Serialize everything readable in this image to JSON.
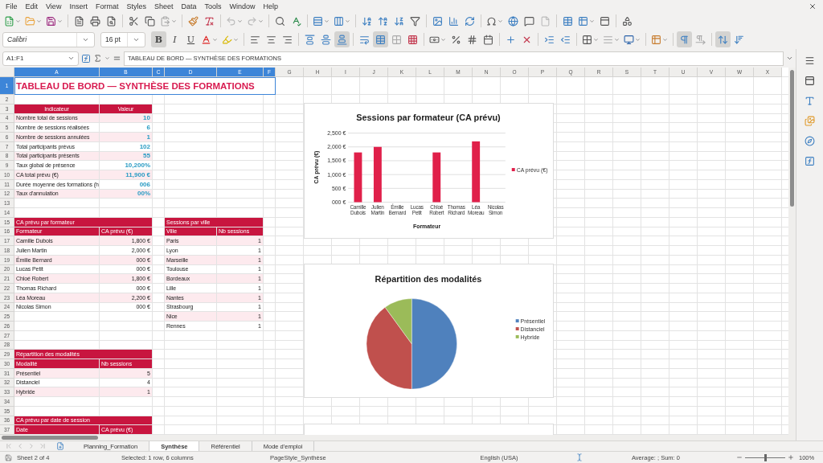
{
  "menu": [
    "File",
    "Edit",
    "View",
    "Insert",
    "Format",
    "Styles",
    "Sheet",
    "Data",
    "Tools",
    "Window",
    "Help"
  ],
  "format_toolbar": {
    "font": "Calibri",
    "size": "16 pt",
    "style_buttons": [
      {
        "label": "B",
        "pressed": true
      },
      {
        "label": "I",
        "pressed": false
      },
      {
        "label": "U",
        "pressed": false
      }
    ],
    "tools": [
      {
        "pressed": false
      },
      {
        "pressed": false
      },
      {
        "pressed": false
      },
      {
        "pressed": false
      },
      {
        "pressed": false
      },
      {
        "pressed": false
      },
      {
        "pressed": false
      },
      {
        "pressed": true
      },
      {
        "pressed": false
      },
      {
        "pressed": true
      },
      {
        "pressed": false
      },
      {
        "pressed": false
      },
      {
        "pressed": false
      },
      {
        "pressed": false
      },
      {
        "pressed": false
      },
      {
        "pressed": false
      },
      {
        "pressed": false
      },
      {
        "pressed": false
      },
      {
        "pressed": false
      },
      {
        "pressed": false
      },
      {
        "pressed": false
      },
      {
        "pressed": false
      },
      {
        "pressed": false
      },
      {
        "pressed": false
      },
      {
        "pressed": true
      },
      {
        "pressed": false
      },
      {
        "pressed": true
      },
      {
        "pressed": false
      }
    ]
  },
  "formula_bar": {
    "name_box": "A1:F1",
    "formula": "TABLEAU DE BORD — SYNTHÈSE DES FORMATIONS"
  },
  "sheet": {
    "column_headers": [
      {
        "label": "A",
        "selected": true
      },
      {
        "label": "B",
        "selected": true
      },
      {
        "label": "C",
        "selected": true
      },
      {
        "label": "D",
        "selected": true
      },
      {
        "label": "E",
        "selected": true
      },
      {
        "label": "F",
        "selected": true
      },
      {
        "label": "G",
        "selected": false
      },
      {
        "label": "H",
        "selected": false
      },
      {
        "label": "I",
        "selected": false
      },
      {
        "label": "J",
        "selected": false
      },
      {
        "label": "K",
        "selected": false
      },
      {
        "label": "L",
        "selected": false
      },
      {
        "label": "M",
        "selected": false
      },
      {
        "label": "N",
        "selected": false
      },
      {
        "label": "O",
        "selected": false
      },
      {
        "label": "P",
        "selected": false
      },
      {
        "label": "Q",
        "selected": false
      },
      {
        "label": "R",
        "selected": false
      },
      {
        "label": "S",
        "selected": false
      },
      {
        "label": "T",
        "selected": false
      },
      {
        "label": "U",
        "selected": false
      },
      {
        "label": "V",
        "selected": false
      },
      {
        "label": "W",
        "selected": false
      },
      {
        "label": "X",
        "selected": false
      }
    ],
    "row_headers": [
      {
        "label": "1",
        "selected": true
      },
      {
        "label": "2",
        "selected": false
      },
      {
        "label": "3",
        "selected": false
      },
      {
        "label": "4",
        "selected": false
      },
      {
        "label": "5",
        "selected": false
      },
      {
        "label": "6",
        "selected": false
      },
      {
        "label": "7",
        "selected": false
      },
      {
        "label": "8",
        "selected": false
      },
      {
        "label": "9",
        "selected": false
      },
      {
        "label": "10",
        "selected": false
      },
      {
        "label": "11",
        "selected": false
      },
      {
        "label": "12",
        "selected": false
      },
      {
        "label": "13",
        "selected": false
      },
      {
        "label": "14",
        "selected": false
      },
      {
        "label": "15",
        "selected": false
      },
      {
        "label": "16",
        "selected": false
      },
      {
        "label": "17",
        "selected": false
      },
      {
        "label": "18",
        "selected": false
      },
      {
        "label": "19",
        "selected": false
      },
      {
        "label": "20",
        "selected": false
      },
      {
        "label": "21",
        "selected": false
      },
      {
        "label": "22",
        "selected": false
      },
      {
        "label": "23",
        "selected": false
      },
      {
        "label": "24",
        "selected": false
      },
      {
        "label": "25",
        "selected": false
      },
      {
        "label": "26",
        "selected": false
      },
      {
        "label": "27",
        "selected": false
      },
      {
        "label": "28",
        "selected": false
      },
      {
        "label": "29",
        "selected": false
      },
      {
        "label": "30",
        "selected": false
      },
      {
        "label": "31",
        "selected": false
      },
      {
        "label": "32",
        "selected": false
      },
      {
        "label": "33",
        "selected": false
      },
      {
        "label": "34",
        "selected": false
      },
      {
        "label": "35",
        "selected": false
      },
      {
        "label": "36",
        "selected": false
      },
      {
        "label": "37",
        "selected": false
      }
    ],
    "title": "TABLEAU DE BORD — SYNTHÈSE DES FORMATIONS",
    "indicators": {
      "columns": [
        "Indicateur",
        "Valeur"
      ],
      "rows": [
        [
          "Nombre total de sessions",
          "10"
        ],
        [
          "Nombre de sessions réalisées",
          "6"
        ],
        [
          "Nombre de sessions annulées",
          "1"
        ],
        [
          "Total participants prévus",
          "102"
        ],
        [
          "Total participants présents",
          "55"
        ],
        [
          "Taux global de présence",
          "10,200%"
        ],
        [
          "CA total prévu (€)",
          "11,900 €"
        ],
        [
          "Durée moyenne des formations (h",
          "006"
        ],
        [
          "Taux d'annulation",
          "00%"
        ]
      ]
    },
    "ca_by_trainer": {
      "title": "CA prévu par formateur",
      "columns": [
        "Formateur",
        "CA prévu (€)"
      ],
      "rows": [
        [
          "Camille Dubois",
          "1,800 €"
        ],
        [
          "Julien Martin",
          "2,000 €"
        ],
        [
          "Émilie Bernard",
          "000 €"
        ],
        [
          "Lucas Petit",
          "000 €"
        ],
        [
          "Chloé Robert",
          "1,800 €"
        ],
        [
          "Thomas Richard",
          "000 €"
        ],
        [
          "Léa Moreau",
          "2,200 €"
        ],
        [
          "Nicolas Simon",
          "000 €"
        ]
      ]
    },
    "sessions_by_city": {
      "title": "Sessions par ville",
      "columns": [
        "Ville",
        "Nb sessions"
      ],
      "rows": [
        [
          "Paris",
          "1"
        ],
        [
          "Lyon",
          "1"
        ],
        [
          "Marseille",
          "1"
        ],
        [
          "Toulouse",
          "1"
        ],
        [
          "Bordeaux",
          "1"
        ],
        [
          "Lille",
          "1"
        ],
        [
          "Nantes",
          "1"
        ],
        [
          "Strasbourg",
          "1"
        ],
        [
          "Nice",
          "1"
        ],
        [
          "Rennes",
          "1"
        ]
      ]
    },
    "modalities": {
      "title": "Répartition des modalités",
      "columns": [
        "Modalité",
        "Nb sessions"
      ],
      "rows": [
        [
          "Présentiel",
          "5"
        ],
        [
          "Distanciel",
          "4"
        ],
        [
          "Hybride",
          "1"
        ]
      ]
    },
    "ca_by_date": {
      "title": "CA prévu par date de session",
      "columns": [
        "Date",
        "CA prévu (€)"
      ]
    }
  },
  "charts": [
    {
      "chart_data": {
        "type": "bar",
        "title": "Sessions par formateur (CA prévu)",
        "xlabel": "Formateur",
        "ylabel": "CA prévu (€)",
        "categories": [
          "Camille Dubois",
          "Julien Martin",
          "Émilie Bernard",
          "Lucas Petit",
          "Chloé Robert",
          "Thomas Richard",
          "Léa Moreau",
          "Nicolas Simon"
        ],
        "series": [
          {
            "name": "CA prévu (€)",
            "color": "#e0204a",
            "values": [
              1800,
              2000,
              0,
              0,
              1800,
              0,
              2200,
              0
            ]
          }
        ],
        "grid": true,
        "legend": true,
        "ylim": [
          0,
          2500
        ],
        "yticks": [
          {
            "value": 0,
            "label": "000 €"
          },
          {
            "value": 500,
            "label": "500 €"
          },
          {
            "value": 1000,
            "label": "1,000 €"
          },
          {
            "value": 1500,
            "label": "1,500 €"
          },
          {
            "value": 2000,
            "label": "2,000 €"
          },
          {
            "value": 2500,
            "label": "2,500 €"
          }
        ]
      }
    },
    {
      "chart_data": {
        "type": "pie",
        "title": "Répartition des modalités",
        "categories": [
          "Présentiel",
          "Distanciel",
          "Hybride"
        ],
        "legend": true,
        "series": [
          {
            "values": [
              50,
              40,
              10
            ]
          }
        ],
        "colors": [
          "#4f81bd",
          "#c0504d",
          "#9bbb59"
        ]
      }
    }
  ],
  "sheet_nav": [
    {
      "disabled": true
    },
    {
      "disabled": true
    },
    {
      "disabled": true
    },
    {
      "disabled": true
    }
  ],
  "sheet_tabs": [
    {
      "label": "Planning_Formation",
      "selected": false
    },
    {
      "label": "Synthèse",
      "selected": true
    },
    {
      "label": "Référentiel",
      "selected": false
    },
    {
      "label": "Mode d'emploi",
      "selected": false
    }
  ],
  "status_bar": {
    "sheet": "Sheet 2 of 4",
    "selection": "Selected: 1 row, 6 columns",
    "page_style": "PageStyle_Synthèse",
    "language": "English (USA)",
    "sum": "Average: ; Sum: 0",
    "zoom": {
      "level": 0.5,
      "reading": "100%"
    }
  }
}
